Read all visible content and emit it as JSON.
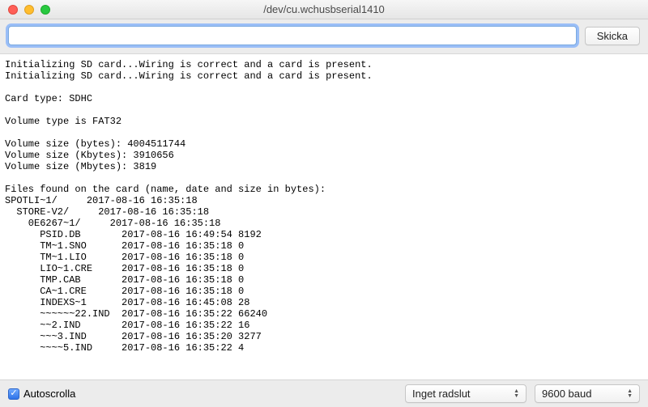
{
  "window": {
    "title": "/dev/cu.wchusbserial1410"
  },
  "toolbar": {
    "input_value": "",
    "input_placeholder": "",
    "send_label": "Skicka"
  },
  "console_output": "Initializing SD card...Wiring is correct and a card is present.\nInitializing SD card...Wiring is correct and a card is present.\n\nCard type: SDHC\n\nVolume type is FAT32\n\nVolume size (bytes): 4004511744\nVolume size (Kbytes): 3910656\nVolume size (Mbytes): 3819\n\nFiles found on the card (name, date and size in bytes):\nSPOTLI~1/     2017-08-16 16:35:18\n  STORE-V2/     2017-08-16 16:35:18\n    0E6267~1/     2017-08-16 16:35:18\n      PSID.DB       2017-08-16 16:49:54 8192\n      TM~1.SNO      2017-08-16 16:35:18 0\n      TM~1.LIO      2017-08-16 16:35:18 0\n      LIO~1.CRE     2017-08-16 16:35:18 0\n      TMP.CAB       2017-08-16 16:35:18 0\n      CA~1.CRE      2017-08-16 16:35:18 0\n      INDEXS~1      2017-08-16 16:45:08 28\n      ~~~~~~22.IND  2017-08-16 16:35:22 66240\n      ~~2.IND       2017-08-16 16:35:22 16\n      ~~~3.IND      2017-08-16 16:35:20 3277\n      ~~~~5.IND     2017-08-16 16:35:22 4",
  "bottom": {
    "autoscroll_label": "Autoscrolla",
    "autoscroll_checked": true,
    "line_ending_select": "Inget radslut",
    "baud_select": "9600 baud"
  }
}
